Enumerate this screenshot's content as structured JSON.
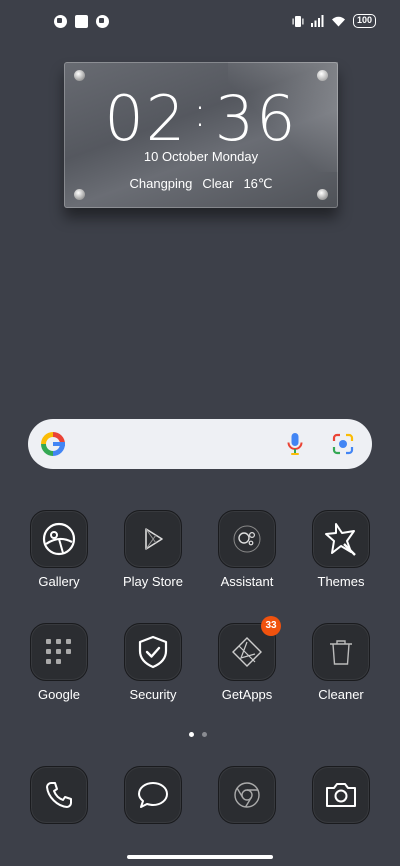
{
  "status_bar": {
    "battery": "100",
    "left_icons": [
      "app-notification-icon",
      "square-notification-icon",
      "app-notification-icon"
    ],
    "right_icons": [
      "vibrate-icon",
      "signal-icon",
      "wifi-icon",
      "battery-icon"
    ]
  },
  "clock_widget": {
    "hours": "02",
    "separator": ":",
    "minutes": "36",
    "date": "10 October Monday",
    "city": "Changping",
    "condition": "Clear",
    "temperature": "16℃"
  },
  "search_bar": {
    "icons": [
      "google-logo-icon",
      "microphone-icon",
      "google-lens-icon"
    ]
  },
  "apps": [
    {
      "label": "Gallery",
      "icon": "gallery-icon"
    },
    {
      "label": "Play Store",
      "icon": "play-store-icon"
    },
    {
      "label": "Assistant",
      "icon": "assistant-icon"
    },
    {
      "label": "Themes",
      "icon": "themes-icon"
    },
    {
      "label": "Google",
      "icon": "google-folder-icon"
    },
    {
      "label": "Security",
      "icon": "security-shield-icon"
    },
    {
      "label": "GetApps",
      "icon": "getapps-icon",
      "badge": "33"
    },
    {
      "label": "Cleaner",
      "icon": "trash-icon"
    }
  ],
  "dock": [
    {
      "icon": "phone-icon"
    },
    {
      "icon": "messages-icon"
    },
    {
      "icon": "chrome-icon"
    },
    {
      "icon": "camera-icon"
    }
  ],
  "pager": {
    "pages": 2,
    "current": 1
  },
  "colors": {
    "background": "#3d4049",
    "tile": "#2b2d31",
    "badge": "#f0520e",
    "search_bar": "#eef0f4"
  }
}
